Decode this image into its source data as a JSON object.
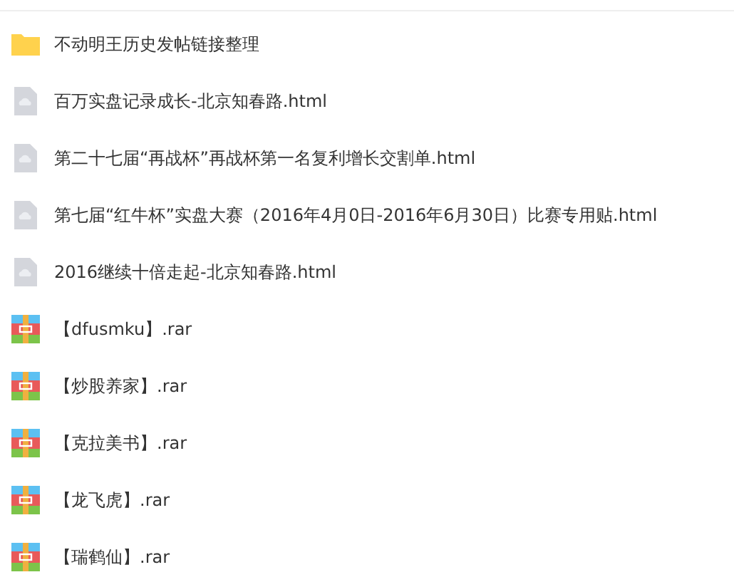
{
  "files": [
    {
      "kind": "folder",
      "name": "不动明王历史发帖链接整理"
    },
    {
      "kind": "html",
      "name": "百万实盘记录成长-北京知春路.html"
    },
    {
      "kind": "html",
      "name": "第二十七届“再战杯”再战杯第一名复利增长交割单.html"
    },
    {
      "kind": "html",
      "name": "第七届“红牛杯”实盘大赛（2016年4月0日-2016年6月30日）比赛专用贴.html"
    },
    {
      "kind": "html",
      "name": "2016继续十倍走起-北京知春路.html"
    },
    {
      "kind": "rar",
      "name": "【dfusmku】.rar"
    },
    {
      "kind": "rar",
      "name": "【炒股养家】.rar"
    },
    {
      "kind": "rar",
      "name": "【克拉美书】.rar"
    },
    {
      "kind": "rar",
      "name": "【龙飞虎】.rar"
    },
    {
      "kind": "rar",
      "name": "【瑞鹤仙】.rar"
    }
  ]
}
